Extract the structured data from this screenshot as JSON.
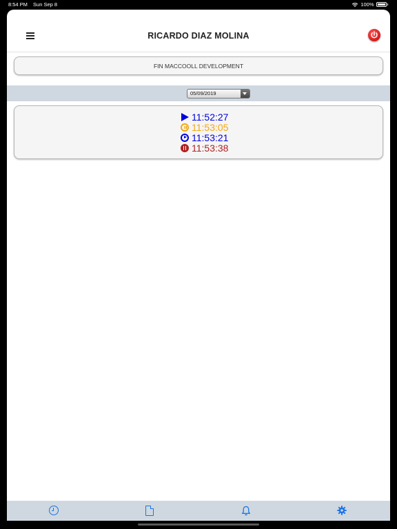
{
  "status_bar": {
    "time": "8:54 PM",
    "date": "Sun Sep 8",
    "battery": "100%"
  },
  "header": {
    "title": "RICARDO DIAZ MOLINA"
  },
  "project": {
    "name": "FIN MACCOOLL DEVELOPMENT"
  },
  "date_filter": {
    "selected": "05/09/2019"
  },
  "time_entries": [
    {
      "icon": "play-icon",
      "time": "11:52:27",
      "color": "#0000e0"
    },
    {
      "icon": "pause-circle-icon",
      "time": "11:53:05",
      "color": "#f3a712"
    },
    {
      "icon": "play-circle-icon",
      "time": "11:53:21",
      "color": "#0000e0"
    },
    {
      "icon": "pause-filled-circle-icon",
      "time": "11:53:38",
      "color": "#b02020"
    }
  ],
  "tab_bar": {
    "tabs": [
      {
        "icon": "clock-icon"
      },
      {
        "icon": "document-icon"
      },
      {
        "icon": "bell-icon"
      },
      {
        "icon": "gear-icon"
      }
    ]
  },
  "colors": {
    "accent": "#1a73e8",
    "band": "#cfd8e0",
    "power": "#d10000"
  }
}
